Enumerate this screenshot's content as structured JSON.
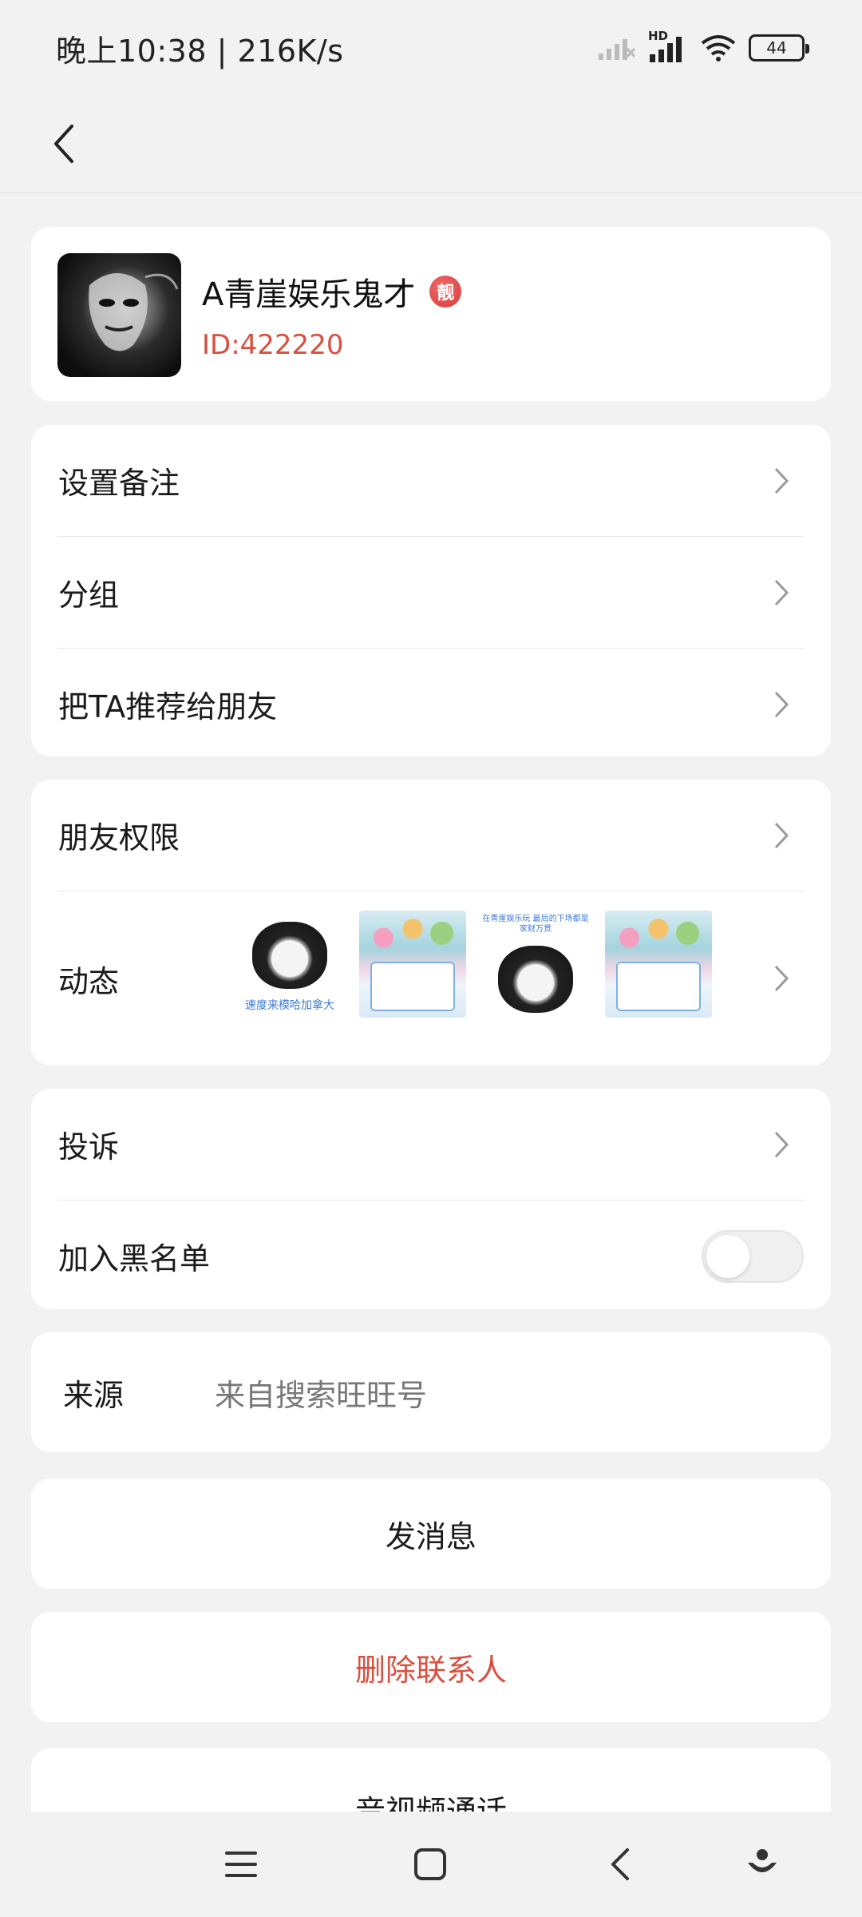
{
  "status_bar": {
    "time_and_speed": "晚上10:38 | 216K/s",
    "network_label": "HD",
    "battery_level": "44"
  },
  "profile": {
    "nickname": "A青崖娱乐鬼才",
    "badge": "靓",
    "user_id": "ID:422220"
  },
  "menu1": {
    "set_remark": "设置备注",
    "group": "分组",
    "recommend": "把TA推荐给朋友"
  },
  "menu2": {
    "friend_permission": "朋友权限",
    "moments": "动态",
    "thumb_captions": [
      "速度来模哈加拿大",
      "",
      "在青崖娱乐玩 最后的下场都是家财万贯",
      ""
    ]
  },
  "menu3": {
    "report": "投诉",
    "blacklist": "加入黑名单",
    "blacklist_on": false
  },
  "source": {
    "label": "来源",
    "value": "来自搜索旺旺号"
  },
  "actions": {
    "send_message": "发消息",
    "delete_contact": "删除联系人",
    "av_call": "音视频通话"
  },
  "colors": {
    "accent_red": "#d9503f",
    "background": "#f2f2f2"
  }
}
